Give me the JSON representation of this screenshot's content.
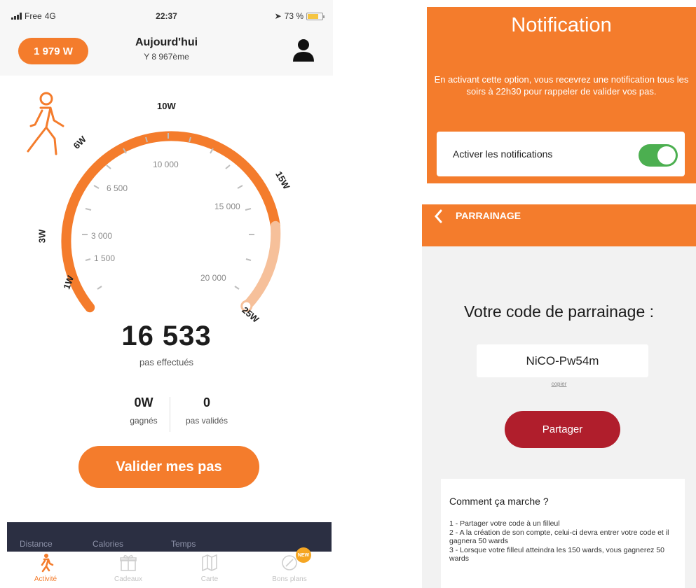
{
  "left_phone": {
    "status_bar": {
      "carrier": "Free",
      "network": "4G",
      "time": "22:37",
      "battery": "73 %",
      "battery_level": 0.73
    },
    "header": {
      "balance": "1 979 W",
      "title": "Aujourd'hui",
      "rank": "Y 8 967ème"
    },
    "gauge": {
      "ward_markers": [
        "1W",
        "3W",
        "6W",
        "10W",
        "15W",
        "25W"
      ],
      "step_scale": [
        "1 500",
        "3 000",
        "6 500",
        "10 000",
        "15 000",
        "20 000"
      ],
      "progress_color": "#f47c2c",
      "remaining_color": "#f6c09a"
    },
    "steps": {
      "value": "16 533",
      "label": "pas effectués"
    },
    "stats": [
      {
        "value": "0W",
        "label": "gagnés"
      },
      {
        "value": "0",
        "label": "pas validés"
      }
    ],
    "validate_button": "Valider mes pas",
    "summary_strip": [
      "Distance",
      "Calories",
      "Temps"
    ],
    "tabs": [
      {
        "label": "Activité",
        "icon": "walk-icon",
        "active": true
      },
      {
        "label": "Cadeaux",
        "icon": "gift-icon",
        "active": false
      },
      {
        "label": "Carte",
        "icon": "map-icon",
        "active": false
      },
      {
        "label": "Bons plans",
        "icon": "deals-icon",
        "active": false,
        "badge": "NEW"
      }
    ]
  },
  "notification": {
    "title": "Notification",
    "description": "En activant cette option, vous recevrez une notification tous les soirs à 22h30 pour rappeler de valider vos pas.",
    "toggle_label": "Activer les notifications",
    "toggle_on": true,
    "toggle_color": "#4caf50"
  },
  "referral": {
    "header_title": "PARRAINAGE",
    "heading": "Votre code de parrainage :",
    "code": "NiCO-Pw54m",
    "copy_link": "copier",
    "share_button": "Partager",
    "how_title": "Comment ça marche ?",
    "how_text": "1 - Partager votre code à un filleul\n2 - A la création de son compte, celui-ci devra entrer votre code et il gagnera 50 wards\n3 - Lorsque votre filleul atteindra les 150 wards, vous gagnerez 50 wards",
    "share_color": "#b01e2c"
  },
  "colors": {
    "brand_orange": "#f47c2c",
    "navy": "#2b2f42"
  }
}
